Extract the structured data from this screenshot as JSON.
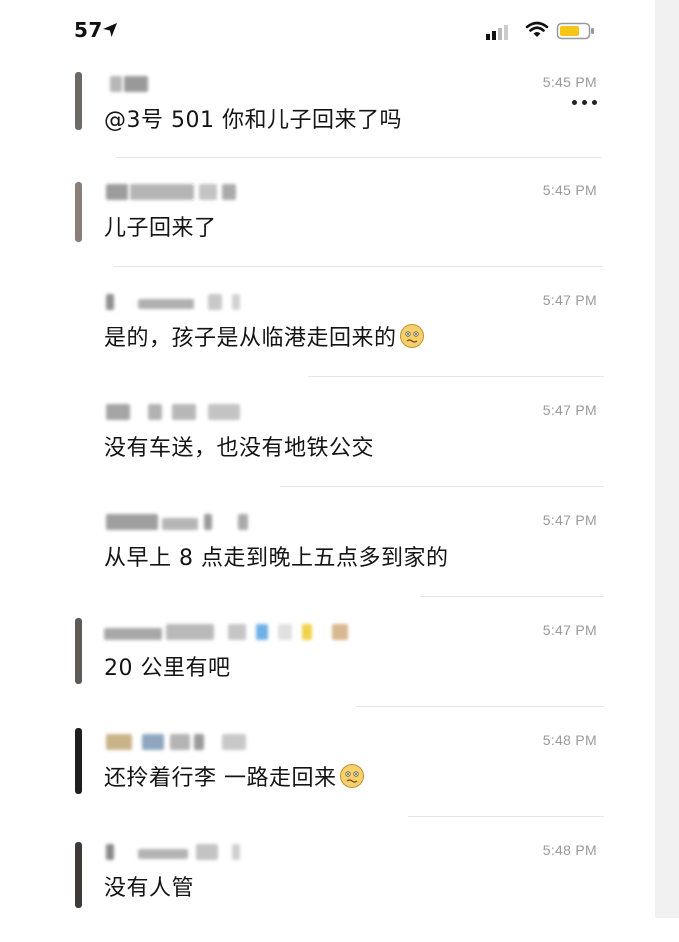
{
  "status_bar": {
    "time": "57",
    "icons": [
      "location-arrow-icon",
      "cellular-signal-icon",
      "wifi-icon",
      "battery-icon"
    ]
  },
  "header": {
    "more_icon": "more-horizontal-icon"
  },
  "messages": [
    {
      "text": "@3号 501 你和儿子回来了吗",
      "time": "5:45 PM",
      "emoji": null
    },
    {
      "text": "儿子回来了",
      "time": "5:45 PM",
      "emoji": null
    },
    {
      "text": "是的，孩子是从临港走回来的",
      "time": "5:47 PM",
      "emoji": "woozy-face-icon"
    },
    {
      "text": "没有车送，也没有地铁公交",
      "time": "5:47 PM",
      "emoji": null
    },
    {
      "text": "从早上 8 点走到晚上五点多到家的",
      "time": "5:47 PM",
      "emoji": null
    },
    {
      "text": "20 公里有吧",
      "time": "5:47 PM",
      "emoji": null
    },
    {
      "text": "还拎着行李 一路走回来",
      "time": "5:48 PM",
      "emoji": "woozy-face-icon"
    },
    {
      "text": "没有人管",
      "time": "5:48 PM",
      "emoji": null
    }
  ],
  "colors": {
    "timestamp": "#9a9a9a",
    "battery": "#f5c518",
    "divider": "#e6e6e6"
  }
}
